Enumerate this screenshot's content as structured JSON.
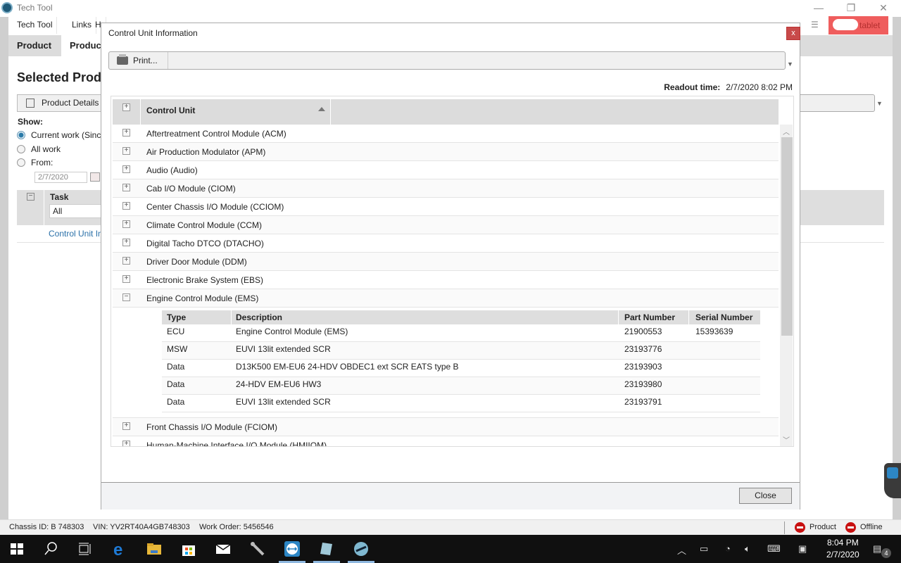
{
  "window": {
    "title": "Tech Tool",
    "minimize": "—",
    "maximize": "❐",
    "close": "✕"
  },
  "menu": [
    "Tech Tool",
    "Links",
    "H"
  ],
  "tabs": [
    "Product",
    "Produc"
  ],
  "tablet_button": "tablet",
  "background": {
    "page_title": "Selected Prod",
    "product_details_button": "Product Details",
    "show_label": "Show:",
    "radios": [
      {
        "label": "Current work (Sinc",
        "selected": true
      },
      {
        "label": "All work",
        "selected": false
      },
      {
        "label": "From:",
        "selected": false
      }
    ],
    "from_date": "2/7/2020",
    "task_header": "Task",
    "task_filter": "All",
    "task_link": "Control Unit In"
  },
  "modal": {
    "title": "Control Unit Information",
    "close_x": "x",
    "print_label": "Print...",
    "readout_label": "Readout time:",
    "readout_value": "2/7/2020 8:02 PM",
    "grid_header": "Control Unit",
    "rows_before": [
      "Aftertreatment Control Module (ACM)",
      "Air Production Modulator (APM)",
      "Audio (Audio)",
      "Cab I/O Module (CIOM)",
      "Center Chassis I/O Module (CCIOM)",
      "Climate Control Module (CCM)",
      "Digital Tacho DTCO (DTACHO)",
      "Driver Door Module (DDM)",
      "Electronic Brake System (EBS)"
    ],
    "expanded_row": "Engine Control Module (EMS)",
    "sub_table": {
      "headers": [
        "Type",
        "Description",
        "Part Number",
        "Serial Number"
      ],
      "rows": [
        [
          "ECU",
          "Engine Control Module (EMS)",
          "21900553",
          "15393639"
        ],
        [
          "MSW",
          "EUVI 13lit extended SCR",
          "23193776",
          ""
        ],
        [
          "Data",
          "D13K500 EM-EU6 24-HDV OBDEC1 ext SCR EATS type B",
          "23193903",
          ""
        ],
        [
          "Data",
          "24-HDV EM-EU6 HW3",
          "23193980",
          ""
        ],
        [
          "Data",
          "EUVI 13lit extended SCR",
          "23193791",
          ""
        ]
      ]
    },
    "rows_after": [
      "Front Chassis I/O Module (FCIOM)",
      "Human-Machine Interface I/O Module (HMIIOM)"
    ],
    "close_button": "Close"
  },
  "statusbar": {
    "chassis": "Chassis ID: B 748303",
    "vin": "VIN: YV2RT40A4GB748303",
    "work_order": "Work Order: 5456546",
    "product_status": "Product",
    "connection_status": "Offline",
    "status_color": "#c81010"
  },
  "taskbar": {
    "time": "8:04 PM",
    "date": "2/7/2020",
    "notification_count": "4"
  }
}
